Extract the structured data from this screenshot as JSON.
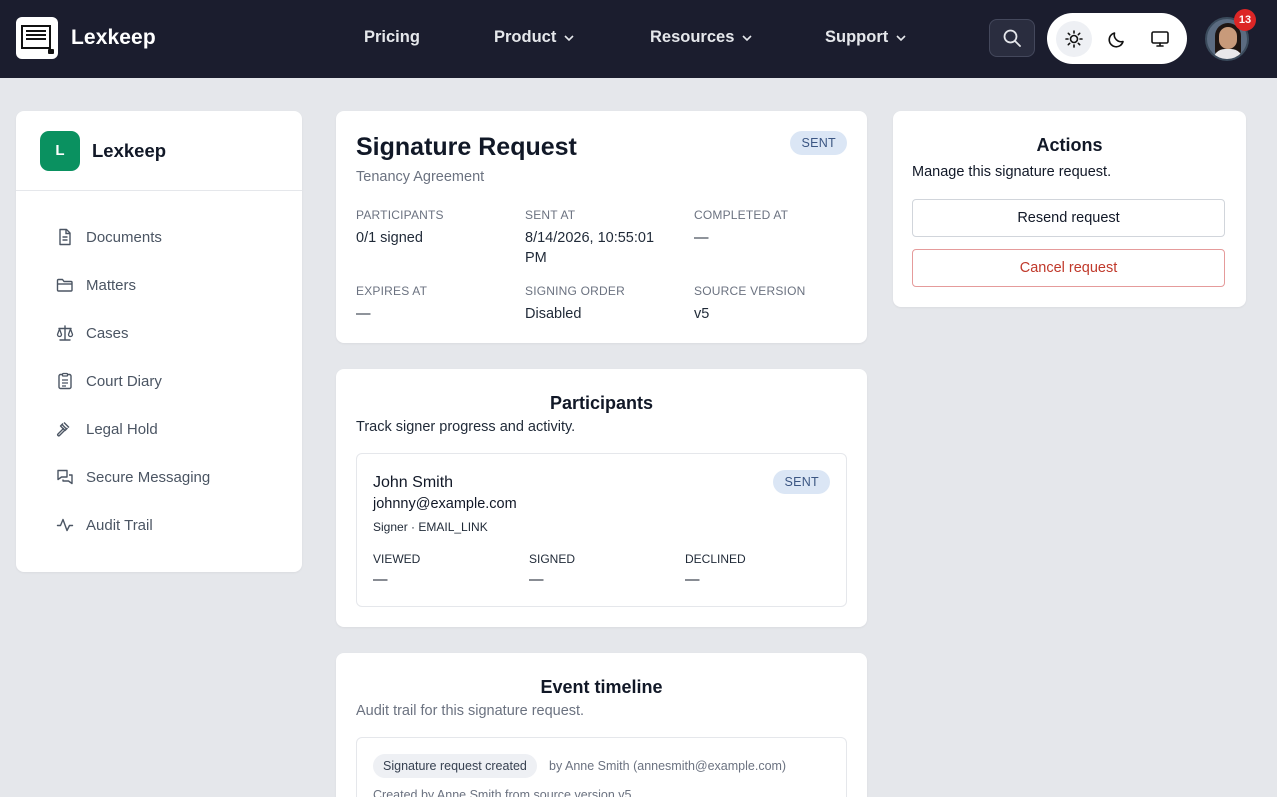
{
  "app": {
    "name": "Lexkeep"
  },
  "nav": {
    "items": [
      {
        "label": "Pricing",
        "dropdown": false
      },
      {
        "label": "Product",
        "dropdown": true
      },
      {
        "label": "Resources",
        "dropdown": true
      },
      {
        "label": "Support",
        "dropdown": true
      }
    ],
    "notifications": "13",
    "theme_active": "light"
  },
  "sidebar": {
    "logo_letter": "L",
    "title": "Lexkeep",
    "items": [
      {
        "label": "Documents",
        "icon": "document-icon"
      },
      {
        "label": "Matters",
        "icon": "folder-icon"
      },
      {
        "label": "Cases",
        "icon": "scale-icon"
      },
      {
        "label": "Court Diary",
        "icon": "clipboard-icon"
      },
      {
        "label": "Legal Hold",
        "icon": "gavel-icon"
      },
      {
        "label": "Secure Messaging",
        "icon": "messages-icon"
      },
      {
        "label": "Audit Trail",
        "icon": "activity-icon"
      }
    ]
  },
  "request": {
    "title": "Signature Request",
    "subtitle": "Tenancy Agreement",
    "status": "SENT",
    "fields": {
      "participants": {
        "label": "PARTICIPANTS",
        "value": "0/1 signed"
      },
      "sent_at": {
        "label": "SENT AT",
        "value": "8/14/2026, 10:55:01 PM"
      },
      "completed_at": {
        "label": "COMPLETED AT",
        "value": "—"
      },
      "expires_at": {
        "label": "EXPIRES AT",
        "value": "—"
      },
      "signing_order": {
        "label": "SIGNING ORDER",
        "value": "Disabled"
      },
      "source_version": {
        "label": "SOURCE VERSION",
        "value": "v5"
      }
    }
  },
  "participants": {
    "title": "Participants",
    "subtitle": "Track signer progress and activity.",
    "list": [
      {
        "name": "John Smith",
        "email": "johnny@example.com",
        "role": "Signer · EMAIL_LINK",
        "status": "SENT",
        "viewed_label": "VIEWED",
        "viewed": "—",
        "signed_label": "SIGNED",
        "signed": "—",
        "declined_label": "DECLINED",
        "declined": "—"
      }
    ]
  },
  "timeline": {
    "title": "Event timeline",
    "subtitle": "Audit trail for this signature request.",
    "events": [
      {
        "tag": "Signature request created",
        "by": "by Anne Smith (annesmith@example.com)",
        "detail": "Created by Anne Smith from source version v5"
      }
    ]
  },
  "actions": {
    "title": "Actions",
    "subtitle": "Manage this signature request.",
    "resend_label": "Resend request",
    "cancel_label": "Cancel request"
  },
  "colors": {
    "topbar": "#1b1d2e",
    "brand_green": "#0a9160",
    "danger": "#c0392b",
    "status_pill_bg": "#dbe6f5"
  }
}
